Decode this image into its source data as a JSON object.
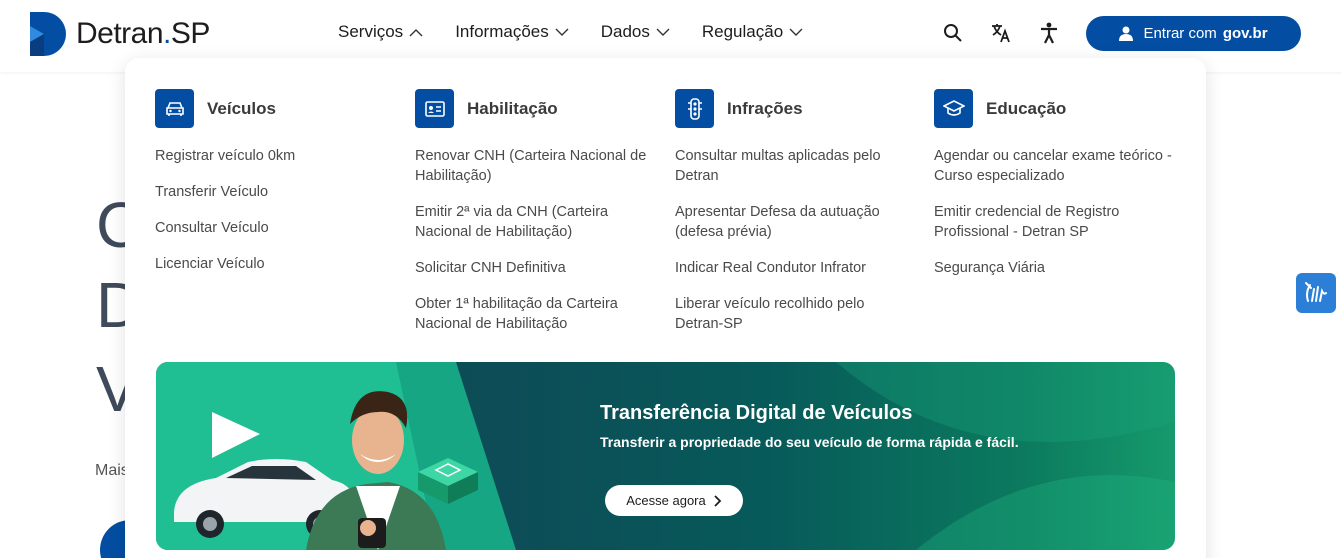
{
  "logo": {
    "text_main": "Detran",
    "text_sep": ".",
    "text_suffix": "SP"
  },
  "nav": [
    {
      "label": "Serviços",
      "open": true
    },
    {
      "label": "Informações",
      "open": false
    },
    {
      "label": "Dados",
      "open": false
    },
    {
      "label": "Regulação",
      "open": false
    }
  ],
  "tools": {
    "search_icon": "search-icon",
    "translate_icon": "translate-icon",
    "accessibility_icon": "accessibility-icon"
  },
  "login": {
    "label": "Entrar com",
    "brand": "gov.br"
  },
  "background": {
    "line1": "C",
    "line2": "D",
    "line3": "V",
    "small_text": "Mais"
  },
  "menu": {
    "columns": [
      {
        "title": "Veículos",
        "icon": "car-icon",
        "links": [
          "Registrar veículo 0km",
          "Transferir Veículo",
          "Consultar Veículo",
          "Licenciar Veículo"
        ]
      },
      {
        "title": "Habilitação",
        "icon": "id-card-icon",
        "links": [
          "Renovar CNH (Carteira Nacional de Habilitação)",
          "Emitir 2ª via da CNH (Carteira Nacional de Habilitação)",
          "Solicitar CNH Definitiva",
          "Obter 1ª habilitação da Carteira Nacional de Habilitação"
        ]
      },
      {
        "title": "Infrações",
        "icon": "traffic-light-icon",
        "links": [
          "Consultar multas aplicadas pelo Detran",
          "Apresentar Defesa da autuação (defesa prévia)",
          "Indicar Real Condutor Infrator",
          "Liberar veículo recolhido pelo Detran-SP"
        ]
      },
      {
        "title": "Educação",
        "icon": "graduation-cap-icon",
        "links": [
          "Agendar ou cancelar exame teórico - Curso especializado",
          "Emitir credencial de Registro Profissional - Detran SP",
          "Segurança Viária"
        ]
      }
    ]
  },
  "banner": {
    "title": "Transferência Digital de Veículos",
    "subtitle": "Transferir a propriedade do seu veículo de forma rápida e fácil.",
    "button": "Acesse agora"
  },
  "colors": {
    "brand": "#034ea2",
    "banner_dark": "#0e4a53",
    "banner_green": "#169a6c"
  },
  "side_widget": {
    "icon": "sign-language-icon"
  }
}
